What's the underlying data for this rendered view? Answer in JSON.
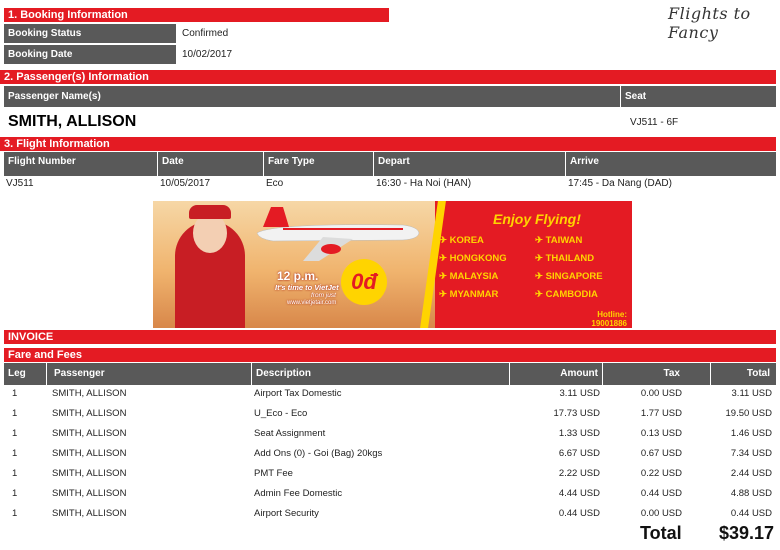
{
  "brand": "Flights to Fancy",
  "booking": {
    "section_title": "1. Booking Information",
    "status_label": "Booking Status",
    "status_value": "Confirmed",
    "date_label": "Booking Date",
    "date_value": "10/02/2017"
  },
  "passengers": {
    "section_title": "2. Passenger(s) Information",
    "name_header": "Passenger Name(s)",
    "seat_header": "Seat",
    "name": "SMITH, ALLISON",
    "seat": "VJ511 - 6F"
  },
  "flight": {
    "section_title": "3. Flight Information",
    "headers": [
      "Flight Number",
      "Date",
      "Fare Type",
      "Depart",
      "Arrive"
    ],
    "row": [
      "VJ511",
      "10/05/2017",
      "Eco",
      "16:30 - Ha Noi (HAN)",
      "17:45 - Da Nang (DAD)"
    ]
  },
  "banner": {
    "headline": "Enjoy Flying!",
    "destinations": [
      "KOREA",
      "TAIWAN",
      "HONGKONG",
      "THAILAND",
      "MALAYSIA",
      "SINGAPORE",
      "MYANMAR",
      "CAMBODIA"
    ],
    "promo_time": "12 p.m.",
    "promo_line": "It's time to VietJet",
    "promo_from": "from just",
    "promo_url": "www.vietjetair.com",
    "promo_price": "0đ",
    "hotline_label": "Hotline:",
    "hotline_number": "19001886"
  },
  "invoice": {
    "title": "INVOICE",
    "subtitle": "Fare and Fees",
    "headers": [
      "Leg",
      "Passenger",
      "Description",
      "Amount",
      "Tax",
      "Total"
    ],
    "rows": [
      [
        "1",
        "SMITH, ALLISON",
        "Airport Tax Domestic",
        "3.11 USD",
        "0.00 USD",
        "3.11 USD"
      ],
      [
        "1",
        "SMITH, ALLISON",
        "U_Eco - Eco",
        "17.73 USD",
        "1.77 USD",
        "19.50 USD"
      ],
      [
        "1",
        "SMITH, ALLISON",
        "Seat Assignment",
        "1.33 USD",
        "0.13 USD",
        "1.46 USD"
      ],
      [
        "1",
        "SMITH, ALLISON",
        "Add Ons (0) - Goi (Bag) 20kgs",
        "6.67 USD",
        "0.67 USD",
        "7.34 USD"
      ],
      [
        "1",
        "SMITH, ALLISON",
        "PMT Fee",
        "2.22 USD",
        "0.22 USD",
        "2.44 USD"
      ],
      [
        "1",
        "SMITH, ALLISON",
        "Admin Fee Domestic",
        "4.44 USD",
        "0.44 USD",
        "4.88 USD"
      ],
      [
        "1",
        "SMITH, ALLISON",
        "Airport Security",
        "0.44 USD",
        "0.00 USD",
        "0.44 USD"
      ]
    ],
    "total_label": "Total",
    "total_value": "$39.17"
  },
  "colors": {
    "accent": "#e41b23",
    "header_grey": "#595959",
    "banner_yellow": "#ffd400"
  }
}
